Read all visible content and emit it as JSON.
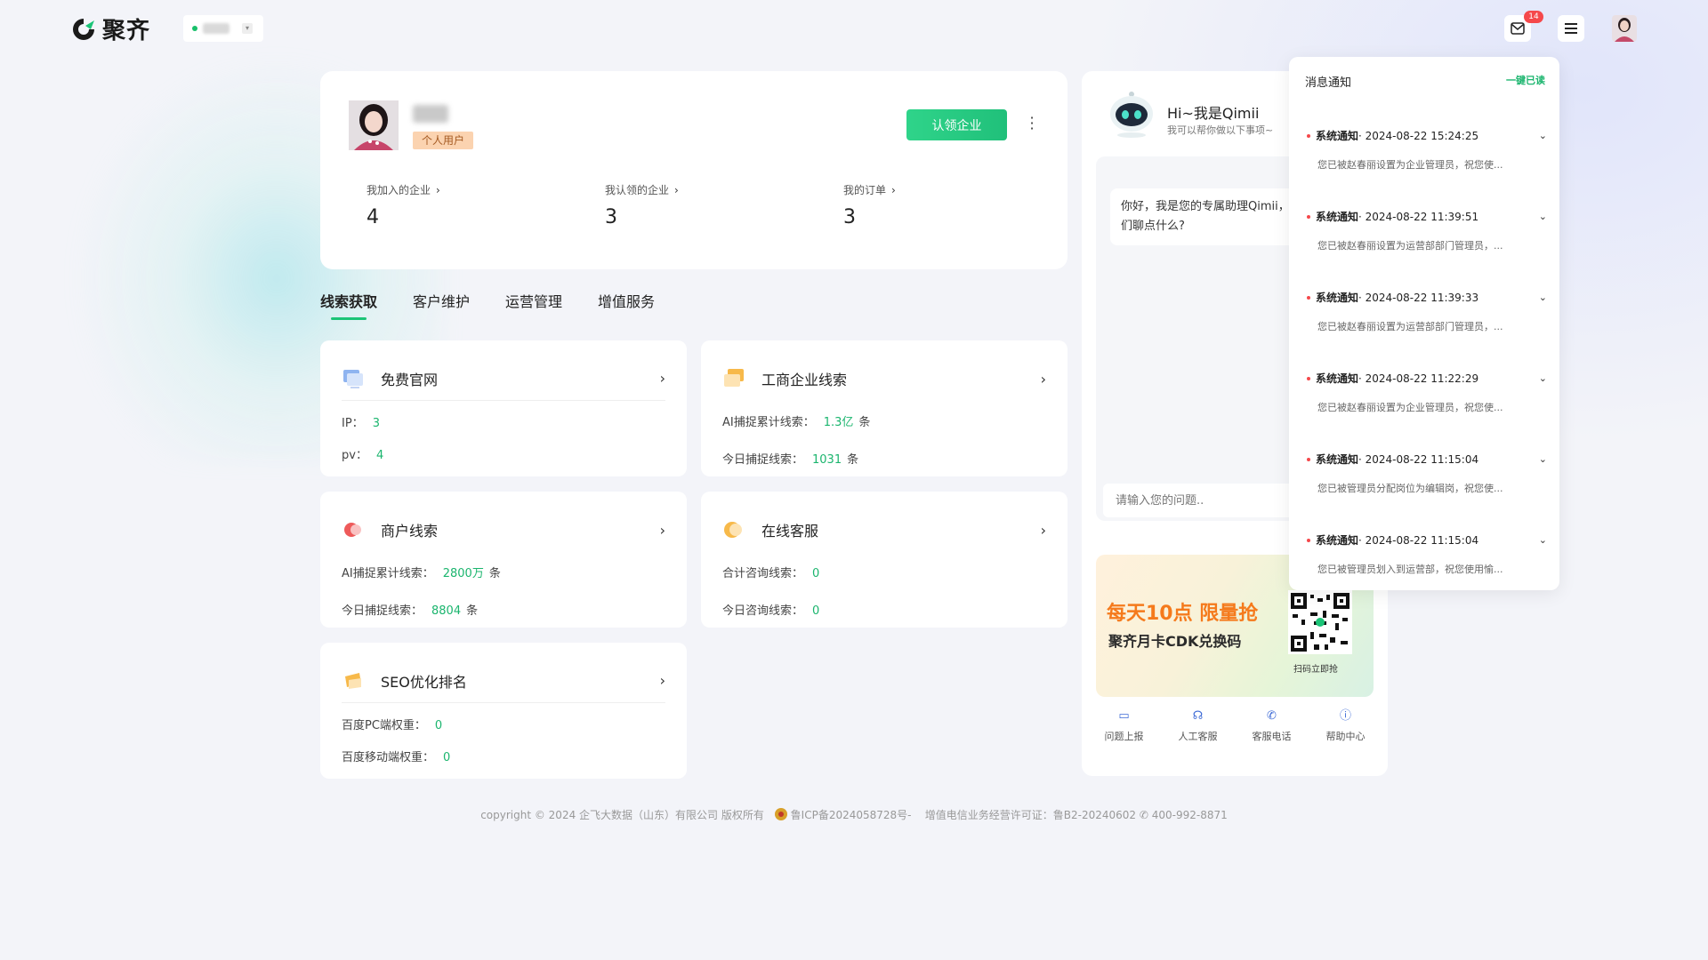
{
  "app": {
    "logo_text": "聚齐"
  },
  "header": {
    "mail_badge": "14"
  },
  "profile": {
    "user_tag": "个人用户",
    "claim_button": "认领企业",
    "stats": [
      {
        "label": "我加入的企业",
        "value": "4"
      },
      {
        "label": "我认领的企业",
        "value": "3"
      },
      {
        "label": "我的订单",
        "value": "3"
      }
    ]
  },
  "tabs": [
    "线索获取",
    "客户维护",
    "运营管理",
    "增值服务"
  ],
  "features": {
    "free_site": {
      "title": "免费官网",
      "l1_label": "IP：",
      "l1_value": "3",
      "l2_label": "pv：",
      "l2_value": "4"
    },
    "business_leads": {
      "title": "工商企业线索",
      "l1_label": "AI捕捉累计线索：",
      "l1_value": "1.3亿",
      "l1_unit": "条",
      "l2_label": "今日捕捉线索：",
      "l2_value": "1031",
      "l2_unit": "条"
    },
    "merchant_leads": {
      "title": "商户线索",
      "l1_label": "AI捕捉累计线索：",
      "l1_value": "2800万",
      "l1_unit": "条",
      "l2_label": "今日捕捉线索：",
      "l2_value": "8804",
      "l2_unit": "条"
    },
    "online_service": {
      "title": "在线客服",
      "l1_label": "合计咨询线索：",
      "l1_value": "0",
      "l2_label": "今日咨询线索：",
      "l2_value": "0"
    },
    "seo": {
      "title": "SEO优化排名",
      "l1_label": "百度PC端权重：",
      "l1_value": "0",
      "l2_label": "百度移动端权重：",
      "l2_value": "0"
    }
  },
  "assistant": {
    "title": "Hi~我是Qimii",
    "subtitle": "我可以帮你做以下事项~",
    "greeting": "你好，我是您的专属助理Qimii，我们聊点什么?",
    "input_placeholder": "请输入您的问题..",
    "promo_line1": "每天10点 限量抢",
    "promo_line2": "聚齐月卡CDK兑换码",
    "promo_qr_caption": "扫码立即抢",
    "actions": [
      "问题上报",
      "人工客服",
      "客服电话",
      "帮助中心"
    ]
  },
  "notifications": {
    "title": "消息通知",
    "read_all": "一键已读",
    "items": [
      {
        "type": "系统通知",
        "time": "· 2024-08-22 15:24:25",
        "body": "您已被赵春丽设置为企业管理员，祝您使..."
      },
      {
        "type": "系统通知",
        "time": "· 2024-08-22 11:39:51",
        "body": "您已被赵春丽设置为运营部部门管理员，..."
      },
      {
        "type": "系统通知",
        "time": "· 2024-08-22 11:39:33",
        "body": "您已被赵春丽设置为运营部部门管理员，..."
      },
      {
        "type": "系统通知",
        "time": "· 2024-08-22 11:22:29",
        "body": "您已被赵春丽设置为企业管理员，祝您使..."
      },
      {
        "type": "系统通知",
        "time": "· 2024-08-22 11:15:04",
        "body": "您已被管理员分配岗位为编辑岗，祝您使..."
      },
      {
        "type": "系统通知",
        "time": "· 2024-08-22 11:15:04",
        "body": "您已被管理员划入到运营部，祝您使用愉..."
      }
    ]
  },
  "footer": {
    "copyright": "copyright © 2024 企飞大数据（山东）有限公司 版权所有",
    "icp": "鲁ICP备2024058728号-",
    "license": "增值电信业务经营许可证：鲁B2-20240602",
    "phone": "400-992-8871"
  }
}
